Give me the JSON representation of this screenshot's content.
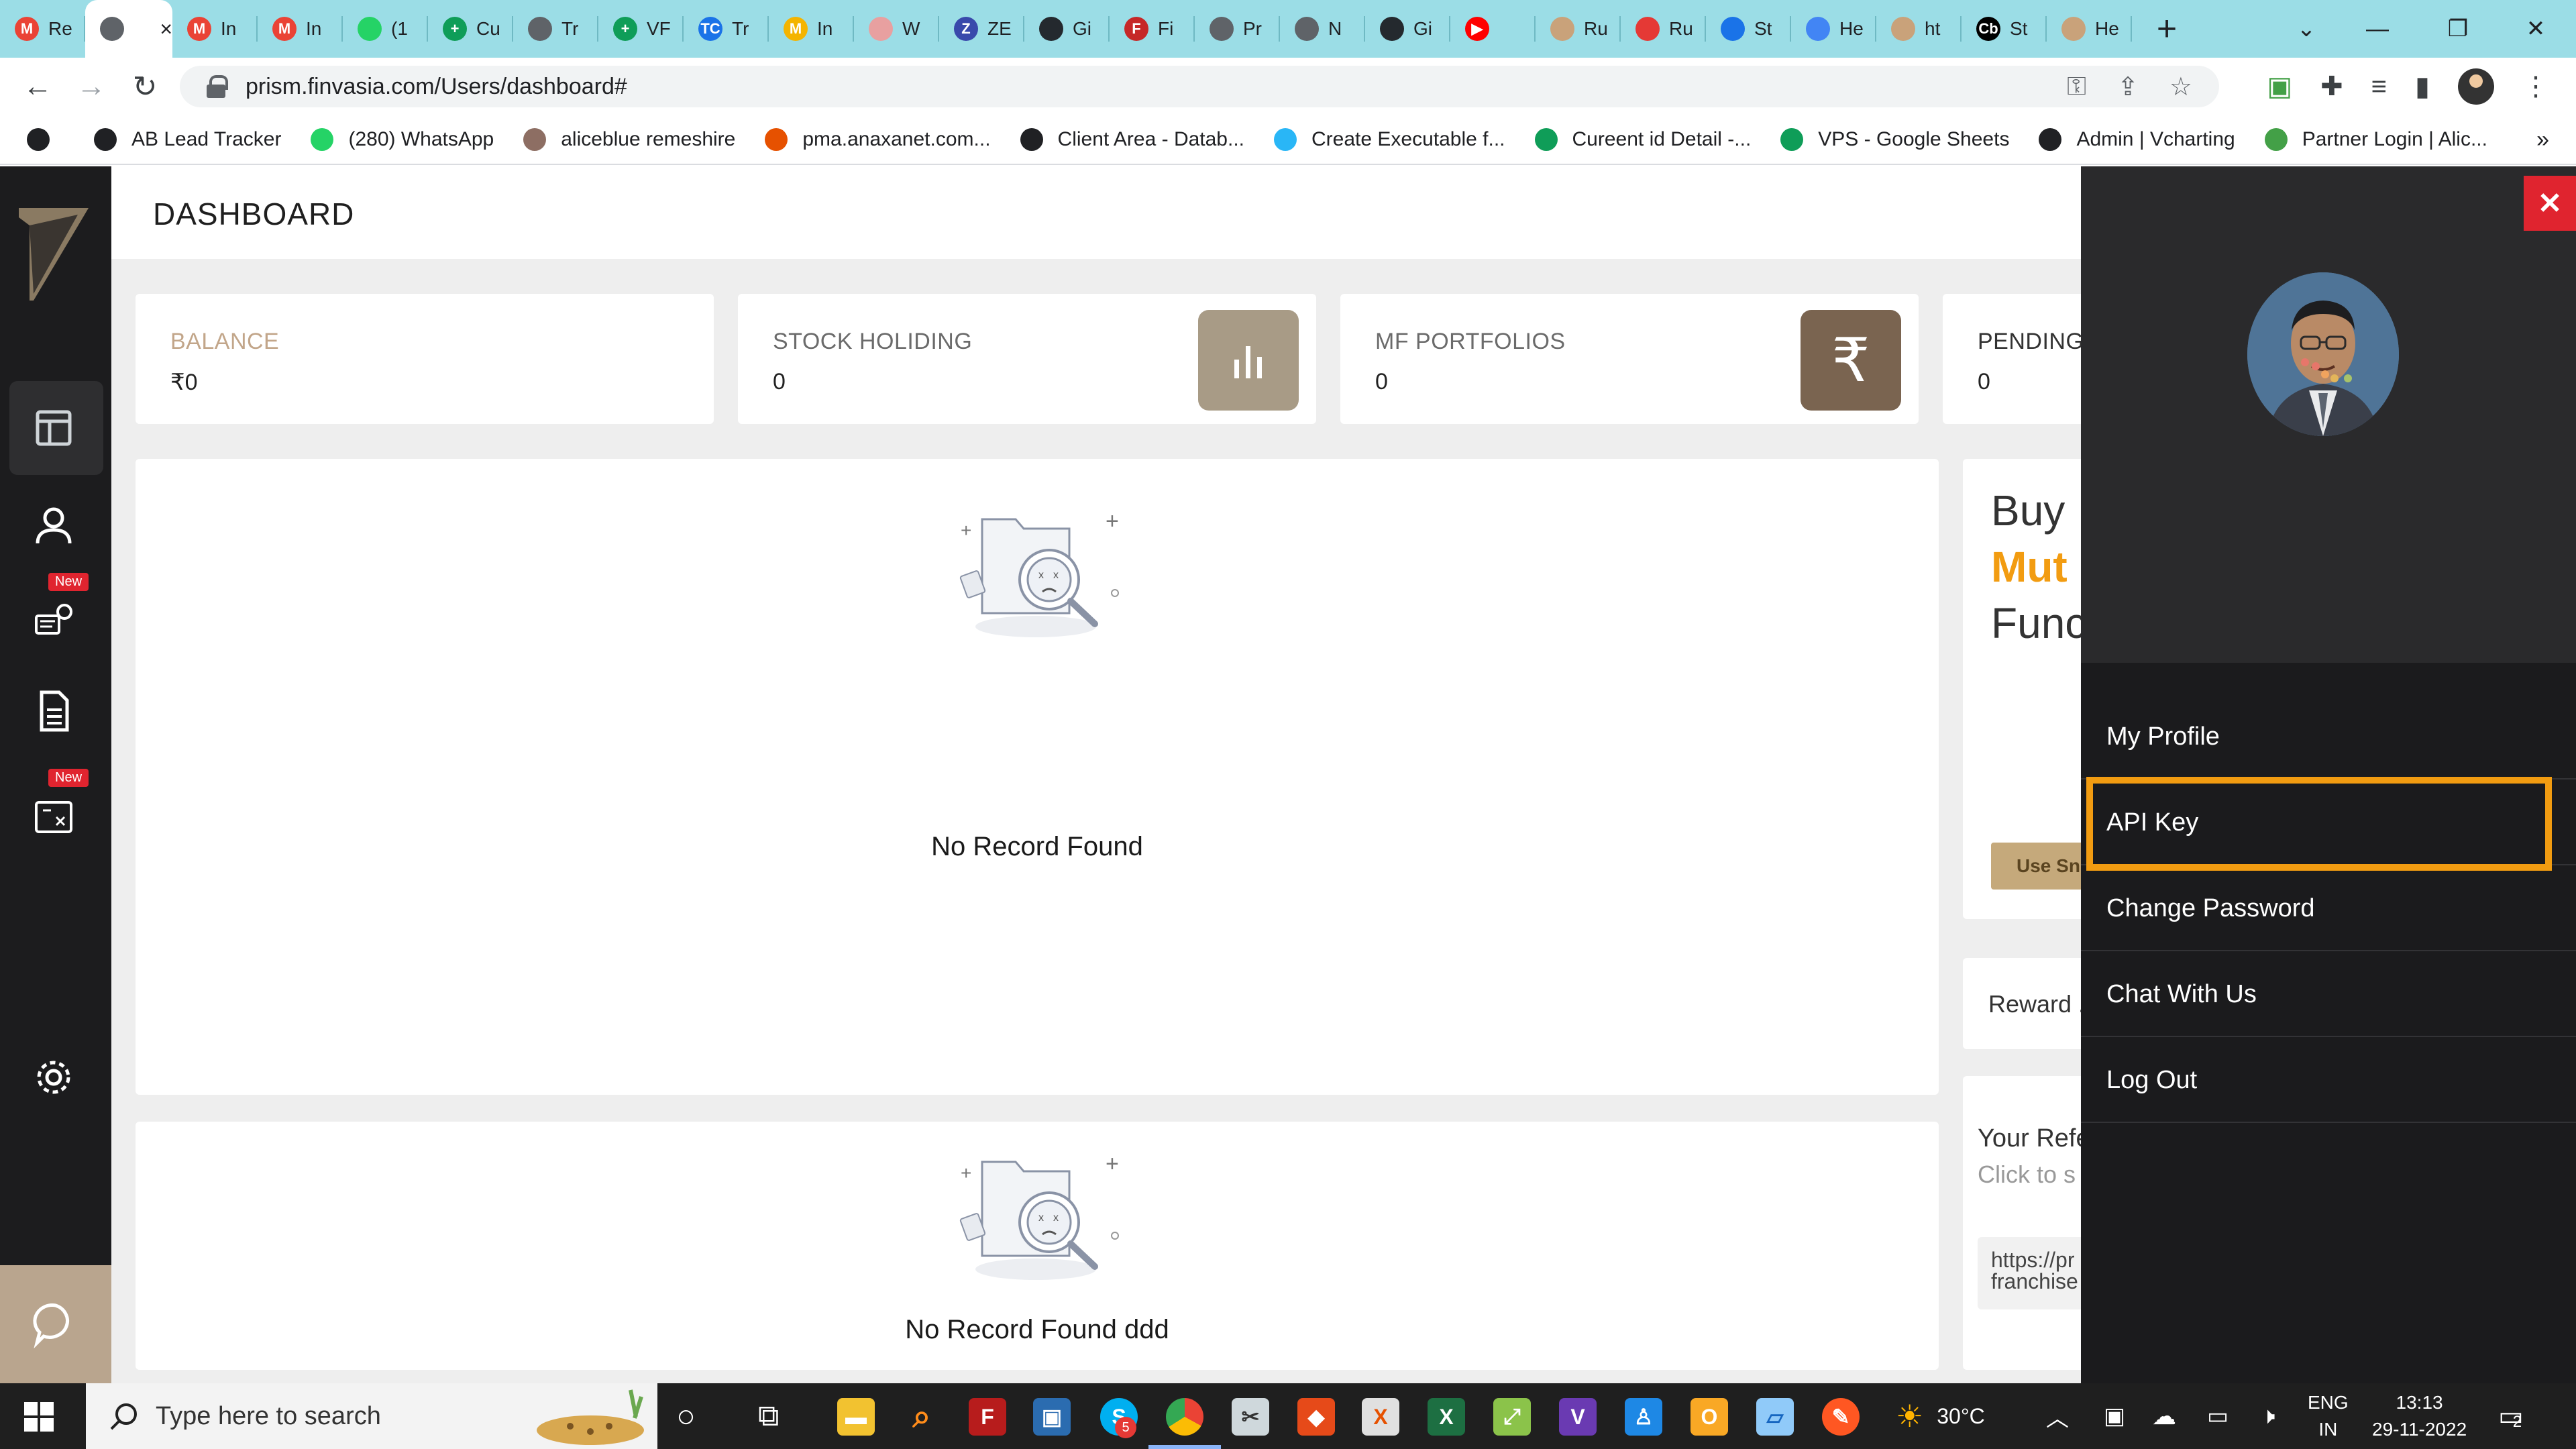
{
  "browser": {
    "tabs": [
      {
        "label": "Re",
        "color": "#ea4335",
        "glyph": "M"
      },
      {
        "label": "",
        "color": "#5f6368",
        "glyph": "",
        "active": true
      },
      {
        "label": "In",
        "color": "#ea4335",
        "glyph": "M"
      },
      {
        "label": "In",
        "color": "#ea4335",
        "glyph": "M"
      },
      {
        "label": "(1",
        "color": "#25d366",
        "glyph": ""
      },
      {
        "label": "Cu",
        "color": "#0f9d58",
        "glyph": "+"
      },
      {
        "label": "Tr",
        "color": "#5f6368",
        "glyph": ""
      },
      {
        "label": "VF",
        "color": "#0f9d58",
        "glyph": "+"
      },
      {
        "label": "Tr",
        "color": "#1a73e8",
        "glyph": "TC"
      },
      {
        "label": "In",
        "color": "#f4b400",
        "glyph": "M"
      },
      {
        "label": "W",
        "color": "#e8a0a0",
        "glyph": ""
      },
      {
        "label": "ZE",
        "color": "#3949ab",
        "glyph": "Z"
      },
      {
        "label": "Gi",
        "color": "#24292e",
        "glyph": ""
      },
      {
        "label": "Fi",
        "color": "#c62828",
        "glyph": "F"
      },
      {
        "label": "Pr",
        "color": "#5f6368",
        "glyph": ""
      },
      {
        "label": "N",
        "color": "#5f6368",
        "glyph": ""
      },
      {
        "label": "Gi",
        "color": "#24292e",
        "glyph": ""
      },
      {
        "label": "",
        "color": "#ff0000",
        "glyph": "▶"
      },
      {
        "label": "Ru",
        "color": "#c9a27a",
        "glyph": ""
      },
      {
        "label": "Ru",
        "color": "#e53935",
        "glyph": ""
      },
      {
        "label": "St",
        "color": "#1a73e8",
        "glyph": ""
      },
      {
        "label": "He",
        "color": "#4285f4",
        "glyph": ""
      },
      {
        "label": "ht",
        "color": "#c9a27a",
        "glyph": ""
      },
      {
        "label": "St",
        "color": "#000000",
        "glyph": "Cb"
      },
      {
        "label": "He",
        "color": "#c9a27a",
        "glyph": ""
      }
    ],
    "url": "prism.finvasia.com/Users/dashboard#",
    "bookmarks": [
      {
        "label": "",
        "color": "#202124"
      },
      {
        "label": "AB Lead Tracker",
        "color": "#202124"
      },
      {
        "label": "(280) WhatsApp",
        "color": "#25d366"
      },
      {
        "label": "aliceblue remeshire",
        "color": "#8d6e63"
      },
      {
        "label": "pma.anaxanet.com...",
        "color": "#e65100"
      },
      {
        "label": "Client Area - Datab...",
        "color": "#202124"
      },
      {
        "label": "Create Executable f...",
        "color": "#29b6f6"
      },
      {
        "label": "Cureent id Detail -...",
        "color": "#0f9d58"
      },
      {
        "label": "VPS - Google Sheets",
        "color": "#0f9d58"
      },
      {
        "label": "Admin | Vcharting",
        "color": "#202124"
      },
      {
        "label": "Partner Login | Alic...",
        "color": "#43a047"
      }
    ],
    "bookmarks_more": "»"
  },
  "sidebar": {
    "new_badge": "New"
  },
  "dashboard": {
    "title": "DASHBOARD",
    "cards": [
      {
        "label": "BALANCE",
        "value": "₹0"
      },
      {
        "label": "STOCK HOLIDING",
        "value": "0"
      },
      {
        "label": "MF PORTFOLIOS",
        "value": "0"
      },
      {
        "label": "PENDING",
        "value": "0"
      }
    ],
    "empty_1": "No Record Found",
    "empty_2": "No Record Found ddd",
    "promo": {
      "line1": "Buy I",
      "line2": "Mut",
      "line3": "Func",
      "button": "Use Sn"
    },
    "reward": "Reward .",
    "referral": {
      "title": "Your Refe",
      "subtitle": "Click to s",
      "link_line1": "https://pr",
      "link_line2": "franchise"
    },
    "accent_color": "#f29c11"
  },
  "drawer": {
    "close": "✕",
    "menu": [
      "My Profile",
      "API Key",
      "Change Password",
      "Chat With Us",
      "Log Out"
    ],
    "highlight_color": "#f29c11"
  },
  "taskbar": {
    "search_placeholder": "Type here to search",
    "weather": "30°C",
    "lang_line1": "ENG",
    "lang_line2": "IN",
    "time": "13:13",
    "date": "29-11-2022",
    "notifications": "2",
    "skype_badge": "5"
  }
}
